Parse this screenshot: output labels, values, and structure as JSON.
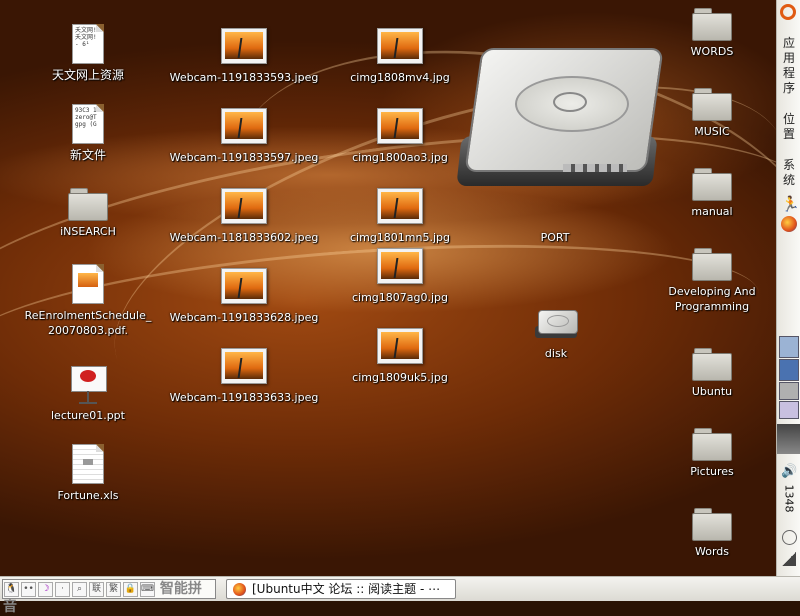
{
  "desktop": {
    "icons": {
      "tianwen": {
        "label": "天文网上资源",
        "preview": [
          "夭文网!",
          "夭文网!",
          "",
          "- 6¹"
        ]
      },
      "newfile": {
        "label": "新文件",
        "preview": [
          "93C3 1",
          "",
          "zero@T",
          "gpg (G"
        ]
      },
      "insearch": {
        "label": "iNSEARCH"
      },
      "reenrol": {
        "label": "ReEnrolmentSchedule_\n20070803.pdf."
      },
      "lecture": {
        "label": "lecture01.ppt"
      },
      "fortune": {
        "label": "Fortune.xls"
      },
      "webcam1": {
        "label": "Webcam-1191833593.jpeg"
      },
      "webcam2": {
        "label": "Webcam-1191833597.jpeg"
      },
      "webcam3": {
        "label": "Webcam-1181833602.jpeg"
      },
      "webcam4": {
        "label": "Webcam-1191833628.jpeg"
      },
      "webcam5": {
        "label": "Webcam-1191833633.jpeg"
      },
      "cimg1": {
        "label": "cimg1808mv4.jpg"
      },
      "cimg2": {
        "label": "cimg1800ao3.jpg"
      },
      "cimg3": {
        "label": "cimg1801mn5.jpg"
      },
      "cimg4": {
        "label": "cimg1807ag0.jpg"
      },
      "cimg5": {
        "label": "cimg1809uk5.jpg"
      },
      "port": {
        "label": "PORT"
      },
      "disk": {
        "label": "disk"
      },
      "words_upper": {
        "label": "WORDS"
      },
      "music": {
        "label": "MUSIC"
      },
      "manual": {
        "label": "manual"
      },
      "developing": {
        "label": "Developing And\nProgramming"
      },
      "ubuntu": {
        "label": "Ubuntu"
      },
      "pictures": {
        "label": "Pictures"
      },
      "words": {
        "label": "Words"
      }
    }
  },
  "right_panel": {
    "applications": "应用程序",
    "places": "位置",
    "system": "系统",
    "clock": "1348"
  },
  "bottom_panel": {
    "ime_name": "智能拼音",
    "ime_buttons": [
      "联",
      "繁"
    ],
    "task_title": "[Ubuntu中文 论坛 :: 阅读主题 - ⋯"
  }
}
